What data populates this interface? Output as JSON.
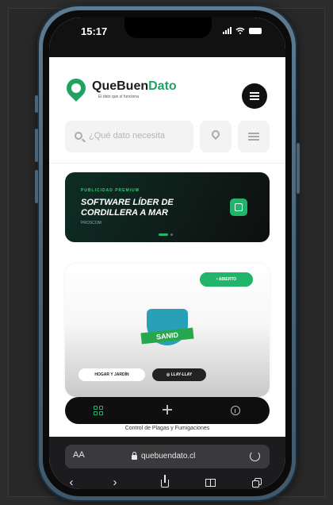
{
  "status_bar": {
    "time": "15:17"
  },
  "header": {
    "brand_part1": "QueBuen",
    "brand_part2": "Dato",
    "tagline": "El dato que sí funciona"
  },
  "search": {
    "placeholder": "¿Qué dato necesita"
  },
  "promo": {
    "tag": "PUBLICIDAD PREMIUM",
    "title": "SOFTWARE LÍDER DE CORDILLERA A MAR",
    "subtitle": "PROSCOM"
  },
  "card": {
    "status": "• ABIERTO",
    "logo_text": "SANID",
    "category": "HOGAR Y JARDÍN",
    "location": "◎ LLAY-LLAY",
    "caption": "Control de Plagas y Fumigaciones"
  },
  "browser": {
    "aa_label": "AA",
    "url": "quebuendato.cl"
  },
  "colors": {
    "accent": "#21b46a",
    "promo_bg": "#0f1d19",
    "tabbar_bg": "#0f0f0f"
  },
  "icons": [
    "search-icon",
    "location-icon",
    "filter-icon",
    "external-link-icon",
    "grid-icon",
    "plus-icon",
    "info-icon",
    "lock-icon",
    "reload-icon",
    "share-icon",
    "book-icon",
    "tabs-icon"
  ]
}
